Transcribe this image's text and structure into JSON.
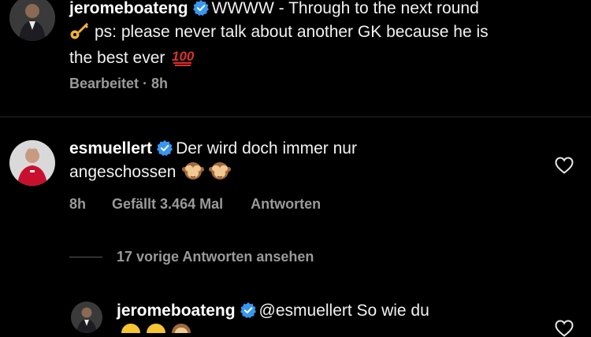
{
  "comments": [
    {
      "username": "jeromeboateng",
      "text_line1": "WWWW - Through to the next round",
      "text_line2": "ps: please never talk about another GK because he is",
      "text_line3": "the best ever",
      "meta_edited": "Bearbeitet · 8h"
    },
    {
      "username": "esmuellert",
      "text_line1": "Der wird doch immer nur",
      "text_line2": "angeschossen",
      "time": "8h",
      "likes": "Gefällt 3.464 Mal",
      "reply_label": "Antworten"
    },
    {
      "username": "jeromeboateng",
      "text_line1": "@esmuellert So wie du"
    }
  ],
  "view_replies_label": "17 vorige Antworten ansehen",
  "icons": {
    "verified": "verified-badge-icon",
    "heart": "heart-outline-icon",
    "key": "key-emoji",
    "hundred": "hundred-points-emoji",
    "see_no_evil": "see-no-evil-monkey-emoji",
    "laughing": "tears-of-joy-emoji"
  },
  "colors": {
    "background": "#000000",
    "verified_blue": "#3897f0",
    "meta_gray": "#9a9a9a"
  }
}
